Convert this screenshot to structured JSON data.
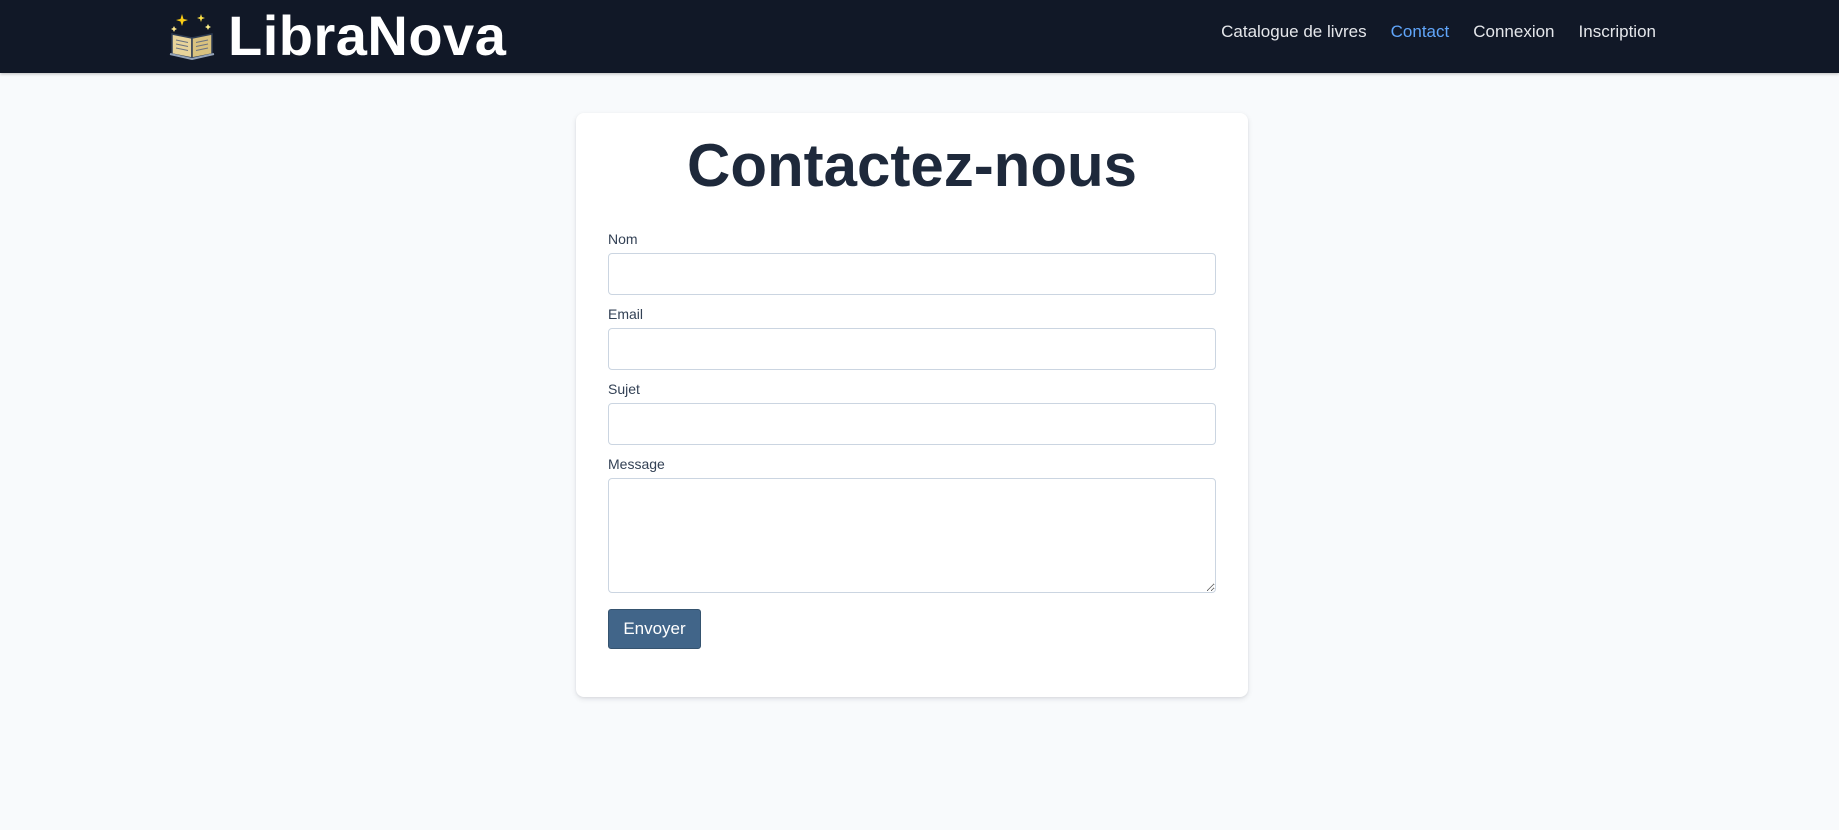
{
  "brand": {
    "name": "LibraNova",
    "icon": "book-sparkles-icon"
  },
  "nav": {
    "items": [
      {
        "label": "Catalogue de livres",
        "active": false
      },
      {
        "label": "Contact",
        "active": true
      },
      {
        "label": "Connexion",
        "active": false
      },
      {
        "label": "Inscription",
        "active": false
      }
    ]
  },
  "contact_form": {
    "title": "Contactez-nous",
    "fields": {
      "name_label": "Nom",
      "name_value": "",
      "email_label": "Email",
      "email_value": "",
      "subject_label": "Sujet",
      "subject_value": "",
      "message_label": "Message",
      "message_value": ""
    },
    "submit_label": "Envoyer"
  },
  "colors": {
    "navbar_bg": "#111827",
    "nav_active": "#60a5fa",
    "button_bg": "#416589",
    "page_bg": "#f8fafc",
    "title_text": "#1e293b"
  }
}
